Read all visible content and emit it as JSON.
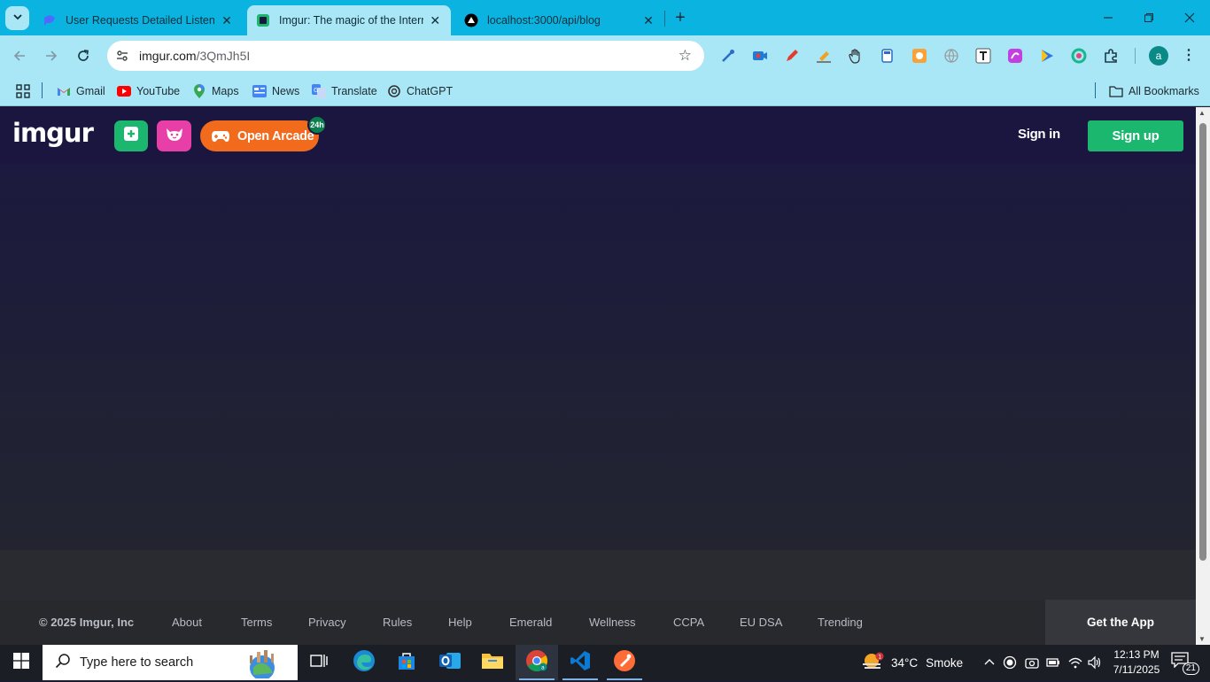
{
  "browser": {
    "tabs": [
      {
        "title": "User Requests Detailed Listening",
        "active": false
      },
      {
        "title": "Imgur: The magic of the Internet",
        "active": true
      },
      {
        "title": "localhost:3000/api/blog",
        "active": false
      }
    ],
    "address_bar": {
      "host": "imgur.com",
      "path": "/3QmJh5I"
    },
    "bookmarks": [
      {
        "label": "Gmail",
        "icon": "gmail-icon"
      },
      {
        "label": "YouTube",
        "icon": "youtube-icon"
      },
      {
        "label": "Maps",
        "icon": "maps-icon"
      },
      {
        "label": "News",
        "icon": "news-icon"
      },
      {
        "label": "Translate",
        "icon": "translate-icon"
      },
      {
        "label": "ChatGPT",
        "icon": "chatgpt-icon"
      }
    ],
    "all_bookmarks_label": "All Bookmarks",
    "profile_initial": "a"
  },
  "imgur": {
    "logo_text": "imgur",
    "arcade_label": "Open Arcade",
    "arcade_badge": "24h",
    "signin_label": "Sign in",
    "signup_label": "Sign up",
    "footer": {
      "copyright": "© 2025 Imgur, Inc",
      "links": [
        "About",
        "Terms",
        "Privacy",
        "Rules",
        "Help",
        "Emerald",
        "Wellness",
        "CCPA",
        "EU DSA",
        "Trending"
      ],
      "get_app": "Get the App"
    },
    "colors": {
      "nav_bg": "#1a1640",
      "green": "#1bb76e",
      "pink": "#e83ea8",
      "orange": "#f26b1d"
    }
  },
  "taskbar": {
    "search_placeholder": "Type here to search",
    "weather": {
      "temp": "34°C",
      "condition": "Smoke"
    },
    "time": "12:13 PM",
    "date": "7/11/2025",
    "notification_count": "21"
  }
}
